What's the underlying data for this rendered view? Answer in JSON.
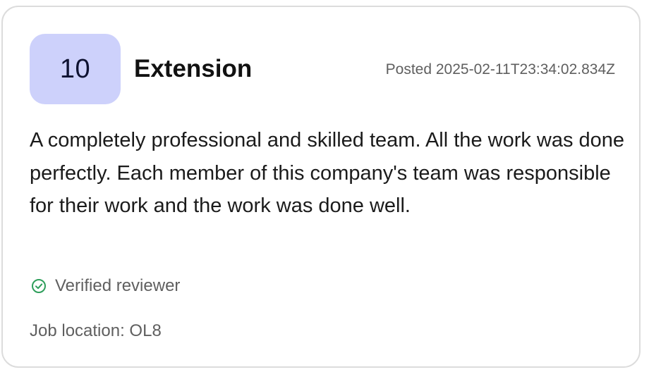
{
  "review": {
    "score": "10",
    "job_title": "Extension",
    "posted": "Posted 2025-02-11T23:34:02.834Z",
    "text": "A completely professional and skilled team. All the work was done perfectly. Each member of this company's team was responsible for their work and the work was done well.",
    "verified_label": "Verified reviewer",
    "job_location": "Job location: OL8"
  },
  "colors": {
    "badge_bg": "#cdd1fb",
    "verified_green": "#2f9e5b",
    "muted_text": "#5f5f5f"
  },
  "icons": {
    "verified": "check-circle-icon"
  }
}
